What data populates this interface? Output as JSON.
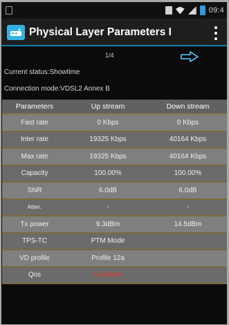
{
  "status_bar": {
    "time": "09:4"
  },
  "action_bar": {
    "title": "Physical Layer Parameters I",
    "app_icon": "modem-icon",
    "overflow_icon": "more-vert-icon"
  },
  "pager": {
    "page": "1/4",
    "next_icon": "arrow-right-icon"
  },
  "info": {
    "current_status": "Current status:Showtime",
    "connection_mode": "Connection mode:VDSL2 Annex B"
  },
  "table": {
    "headers": [
      "Parameters",
      "Up stream",
      "Down stream"
    ],
    "rows": [
      [
        "Fast rate",
        "0 Kbps",
        "0 Kbps"
      ],
      [
        "Inter rate",
        "19325 Kbps",
        "40164 Kbps"
      ],
      [
        "Max rate",
        "19325 Kbps",
        "40164 Kbps"
      ],
      [
        "Capacity",
        "100.00%",
        "100.00%"
      ],
      [
        "SNR",
        "6.0dB",
        "6.0dB"
      ],
      [
        "Atten.",
        "-",
        "-"
      ],
      [
        "Tx power",
        "9.3dBm",
        "14.5dBm"
      ],
      [
        "TPS-TC",
        "PTM Mode",
        ""
      ],
      [
        "VD profile",
        "Profile 12a",
        ""
      ],
      [
        "Qos",
        "Excellent",
        ""
      ]
    ]
  },
  "colors": {
    "accent": "#0f7fb0",
    "app_icon": "#36b1e3",
    "qos_value": "#e13b2c"
  }
}
